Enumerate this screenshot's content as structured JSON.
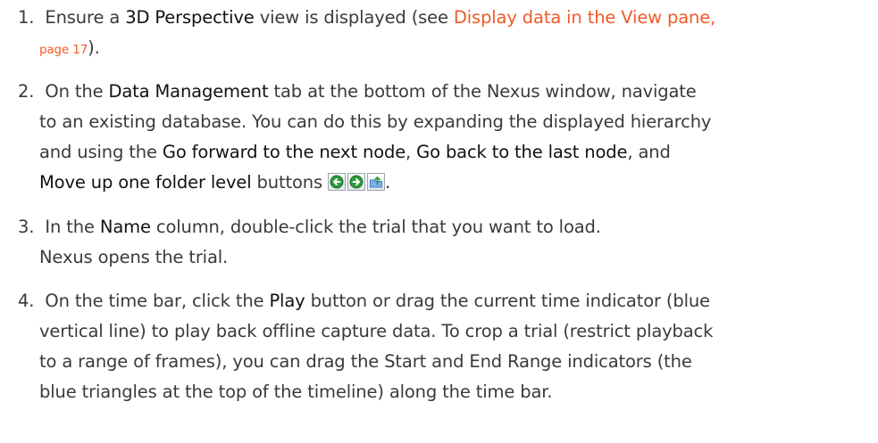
{
  "steps": [
    {
      "number": "1.",
      "l1_t1": "Ensure a ",
      "l1_b1": "3D Perspective",
      "l1_t2": " view is displayed (see ",
      "l1_link": "Display data in the View pane,",
      "l2_link": "page 17",
      "l2_t1": ")."
    },
    {
      "number": "2.",
      "l1_t1": "On the ",
      "l1_b1": "Data Management",
      "l1_t2": " tab at the bottom of the Nexus window, navigate",
      "l2_t1": "to an existing database. You can do this by expanding the displayed hierarchy",
      "l3_t1": "and using the ",
      "l3_b1": "Go forward to the next node",
      "l3_t2": ", ",
      "l3_b2": "Go back to the last node",
      "l3_t3": ", and",
      "l4_b1": "Move up one folder level",
      "l4_t1": " buttons",
      "l4_t2": "."
    },
    {
      "number": "3.",
      "l1_t1": "In the ",
      "l1_b1": "Name",
      "l1_t2": " column, double-click the trial that you want to load.",
      "l2_t1": "Nexus opens the trial."
    },
    {
      "number": "4.",
      "l1_t1": "On the time bar, click the ",
      "l1_b1": "Play",
      "l1_t2": " button or drag the current time indicator (blue",
      "l2_t1": "vertical line) to play back offline capture data. To crop a trial (restrict playback",
      "l3_t1": "to a range of frames), you can drag the Start and End Range indicators (the",
      "l4_t1": "blue triangles at the top of the timeline) along the time bar."
    }
  ],
  "icons": {
    "back": "green-back-arrow-icon",
    "forward": "green-forward-arrow-icon",
    "up": "folder-up-icon"
  },
  "colors": {
    "link": "#f05a28",
    "text": "#3a3a3a",
    "icon_green": "#2e9b3a",
    "icon_blue": "#3f7fd0"
  }
}
